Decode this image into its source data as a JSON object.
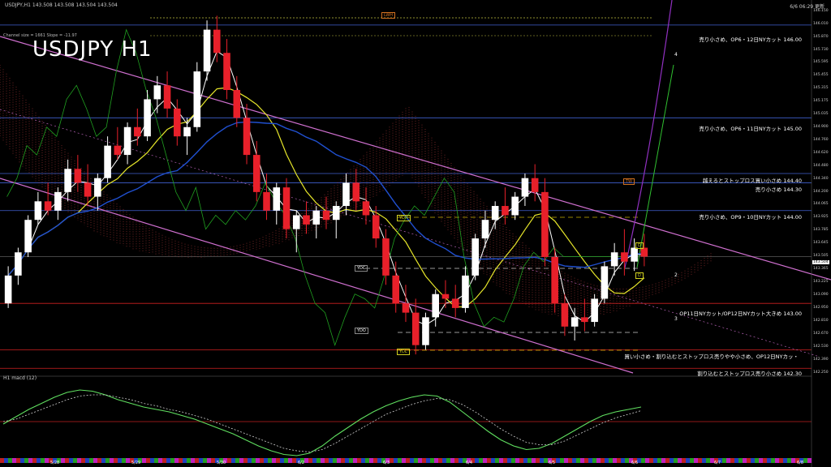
{
  "header": {
    "symbol_info": "USDJPY,H1  143.508 143.508 143.504 143.504",
    "updated": "6/6 06:29 更新",
    "title": "USDJPY H1",
    "channel_info": "Channel size = 1661 Slope = -11.97"
  },
  "colors": {
    "background": "#000000",
    "bull_candle": "#ffffff",
    "bear_candle": "#e8202a",
    "channel": "#d070d0",
    "ma_white": "#ffffff",
    "ma_yellow": "#e6e62a",
    "ma_blue": "#2050d0",
    "chikou": "#20a020",
    "cloud": "#c04040",
    "level_blue": "#4060d0",
    "level_red": "#d02020",
    "level_yellow": "#c8b000",
    "forecast": "#9030c0",
    "macd_main": "#60e060",
    "macd_signal": "#d0d0d0"
  },
  "annotations": [
    {
      "text": "売り小さめ、OP6・12日NYカット 146.00"
    },
    {
      "text": "売り小さめ、OP6・11日NYカット 145.00"
    },
    {
      "text": "越えるとストップロス買い小さめ 144.40"
    },
    {
      "text": "売り小さめ 144.30"
    },
    {
      "text": "売り小さめ、OP9・10日NYカット 144.00"
    },
    {
      "text": "OP11日NYカット/OP12日NYカット大きめ 143.00"
    },
    {
      "text": "買い小さめ・割り込むとストップロス売りやや小さめ、OP12日NYカッ・"
    },
    {
      "text": "割り込むとストップロス売り小さめ 142.30"
    }
  ],
  "boxes": {
    "lwh": "LWH",
    "ydh": "YDH",
    "ydc": "YDC",
    "ydo": "YDO",
    "ydl": "YDL",
    "tw": "TW",
    "d_top": "D",
    "d_bot": "D"
  },
  "wave_numbers": [
    "4",
    "2",
    "3"
  ],
  "price_label": "143.504",
  "macd_label": "H1  macd (12)",
  "chart_data": {
    "type": "candlestick",
    "title": "USDJPY H1",
    "x_labels": [
      "5/28",
      "5/29",
      "5/30",
      "6/2",
      "6/3",
      "6/4",
      "6/5",
      "6/6",
      "6/7",
      "6/8"
    ],
    "y_ticks": [
      "146.150",
      "146.010",
      "145.870",
      "145.730",
      "145.595",
      "145.455",
      "145.315",
      "145.175",
      "145.035",
      "144.900",
      "144.760",
      "144.620",
      "144.480",
      "144.340",
      "144.200",
      "144.065",
      "143.925",
      "143.785",
      "143.645",
      "143.505",
      "143.365",
      "143.225",
      "143.090",
      "142.950",
      "142.810",
      "142.670",
      "142.530",
      "142.390",
      "142.250"
    ],
    "ylim": [
      142.25,
      146.2
    ],
    "last_price": 143.504,
    "ohlc": [
      [
        143.0,
        143.4,
        142.95,
        143.3
      ],
      [
        143.3,
        143.6,
        143.2,
        143.55
      ],
      [
        143.55,
        143.95,
        143.5,
        143.9
      ],
      [
        143.9,
        144.2,
        143.85,
        144.1
      ],
      [
        144.1,
        144.3,
        143.95,
        144.0
      ],
      [
        144.0,
        144.25,
        143.9,
        144.2
      ],
      [
        144.2,
        144.55,
        144.1,
        144.45
      ],
      [
        144.45,
        144.6,
        144.2,
        144.3
      ],
      [
        144.3,
        144.5,
        144.05,
        144.15
      ],
      [
        144.15,
        144.4,
        144.0,
        144.35
      ],
      [
        144.35,
        144.8,
        144.3,
        144.7
      ],
      [
        144.7,
        144.9,
        144.55,
        144.6
      ],
      [
        144.6,
        144.95,
        144.5,
        144.9
      ],
      [
        144.9,
        145.1,
        144.7,
        144.8
      ],
      [
        144.8,
        145.3,
        144.75,
        145.2
      ],
      [
        145.2,
        145.45,
        145.05,
        145.35
      ],
      [
        145.35,
        145.5,
        145.0,
        145.1
      ],
      [
        145.1,
        145.2,
        144.7,
        144.8
      ],
      [
        144.8,
        145.0,
        144.6,
        144.9
      ],
      [
        144.9,
        145.6,
        144.85,
        145.5
      ],
      [
        145.5,
        146.05,
        145.4,
        145.95
      ],
      [
        145.95,
        146.1,
        145.6,
        145.7
      ],
      [
        145.7,
        145.85,
        145.2,
        145.3
      ],
      [
        145.3,
        145.45,
        144.9,
        145.0
      ],
      [
        145.0,
        145.15,
        144.5,
        144.6
      ],
      [
        144.6,
        144.75,
        144.1,
        144.2
      ],
      [
        144.2,
        144.4,
        143.9,
        144.0
      ],
      [
        144.0,
        144.3,
        143.85,
        144.25
      ],
      [
        144.25,
        144.35,
        143.7,
        143.8
      ],
      [
        143.8,
        144.0,
        143.55,
        143.95
      ],
      [
        143.95,
        144.1,
        143.75,
        143.85
      ],
      [
        143.85,
        144.05,
        143.7,
        144.0
      ],
      [
        144.0,
        144.15,
        143.8,
        143.9
      ],
      [
        143.9,
        144.1,
        143.7,
        144.05
      ],
      [
        144.05,
        144.4,
        143.95,
        144.3
      ],
      [
        144.3,
        144.45,
        144.0,
        144.1
      ],
      [
        144.1,
        144.25,
        143.85,
        143.95
      ],
      [
        143.95,
        144.05,
        143.6,
        143.7
      ],
      [
        143.7,
        143.8,
        143.2,
        143.3
      ],
      [
        143.3,
        143.45,
        142.9,
        143.0
      ],
      [
        143.0,
        143.2,
        142.8,
        142.9
      ],
      [
        142.9,
        143.05,
        142.45,
        142.55
      ],
      [
        142.55,
        142.9,
        142.5,
        142.85
      ],
      [
        142.85,
        143.15,
        142.75,
        143.1
      ],
      [
        143.1,
        143.25,
        142.95,
        143.05
      ],
      [
        143.05,
        143.2,
        142.85,
        142.95
      ],
      [
        142.95,
        143.4,
        142.9,
        143.3
      ],
      [
        143.3,
        143.75,
        143.25,
        143.7
      ],
      [
        143.7,
        144.0,
        143.6,
        143.9
      ],
      [
        143.9,
        144.1,
        143.8,
        144.05
      ],
      [
        144.05,
        144.25,
        143.85,
        143.95
      ],
      [
        143.95,
        144.2,
        143.9,
        144.15
      ],
      [
        144.15,
        144.4,
        144.05,
        144.35
      ],
      [
        144.35,
        144.5,
        144.1,
        144.2
      ],
      [
        144.2,
        144.35,
        143.4,
        143.5
      ],
      [
        143.5,
        143.6,
        142.9,
        143.0
      ],
      [
        143.0,
        143.1,
        142.65,
        142.75
      ],
      [
        142.75,
        142.95,
        142.6,
        142.85
      ],
      [
        142.85,
        143.05,
        142.7,
        142.8
      ],
      [
        142.8,
        143.1,
        142.75,
        143.05
      ],
      [
        143.05,
        143.45,
        143.0,
        143.4
      ],
      [
        143.4,
        143.65,
        143.3,
        143.55
      ],
      [
        143.55,
        143.8,
        143.3,
        143.45
      ],
      [
        143.45,
        143.7,
        143.35,
        143.6
      ],
      [
        143.6,
        143.75,
        143.4,
        143.504
      ]
    ],
    "macd": [
      -0.02,
      0.04,
      0.1,
      0.15,
      0.2,
      0.24,
      0.26,
      0.25,
      0.22,
      0.18,
      0.15,
      0.12,
      0.1,
      0.08,
      0.05,
      0.02,
      -0.02,
      -0.06,
      -0.1,
      -0.15,
      -0.2,
      -0.24,
      -0.27,
      -0.28,
      -0.26,
      -0.2,
      -0.12,
      -0.05,
      0.02,
      0.08,
      0.13,
      0.17,
      0.2,
      0.22,
      0.21,
      0.16,
      0.08,
      0.0,
      -0.08,
      -0.15,
      -0.2,
      -0.23,
      -0.22,
      -0.18,
      -0.12,
      -0.06,
      0.0,
      0.05,
      0.08,
      0.1,
      0.12
    ],
    "macd_signal": [
      0.0,
      0.02,
      0.06,
      0.1,
      0.14,
      0.18,
      0.21,
      0.22,
      0.22,
      0.2,
      0.18,
      0.15,
      0.13,
      0.1,
      0.08,
      0.05,
      0.02,
      -0.02,
      -0.06,
      -0.1,
      -0.14,
      -0.18,
      -0.22,
      -0.24,
      -0.25,
      -0.23,
      -0.18,
      -0.12,
      -0.06,
      0.0,
      0.06,
      0.1,
      0.14,
      0.17,
      0.19,
      0.18,
      0.14,
      0.08,
      0.01,
      -0.06,
      -0.12,
      -0.17,
      -0.19,
      -0.19,
      -0.16,
      -0.11,
      -0.06,
      -0.01,
      0.03,
      0.06,
      0.09
    ],
    "grid": false
  }
}
